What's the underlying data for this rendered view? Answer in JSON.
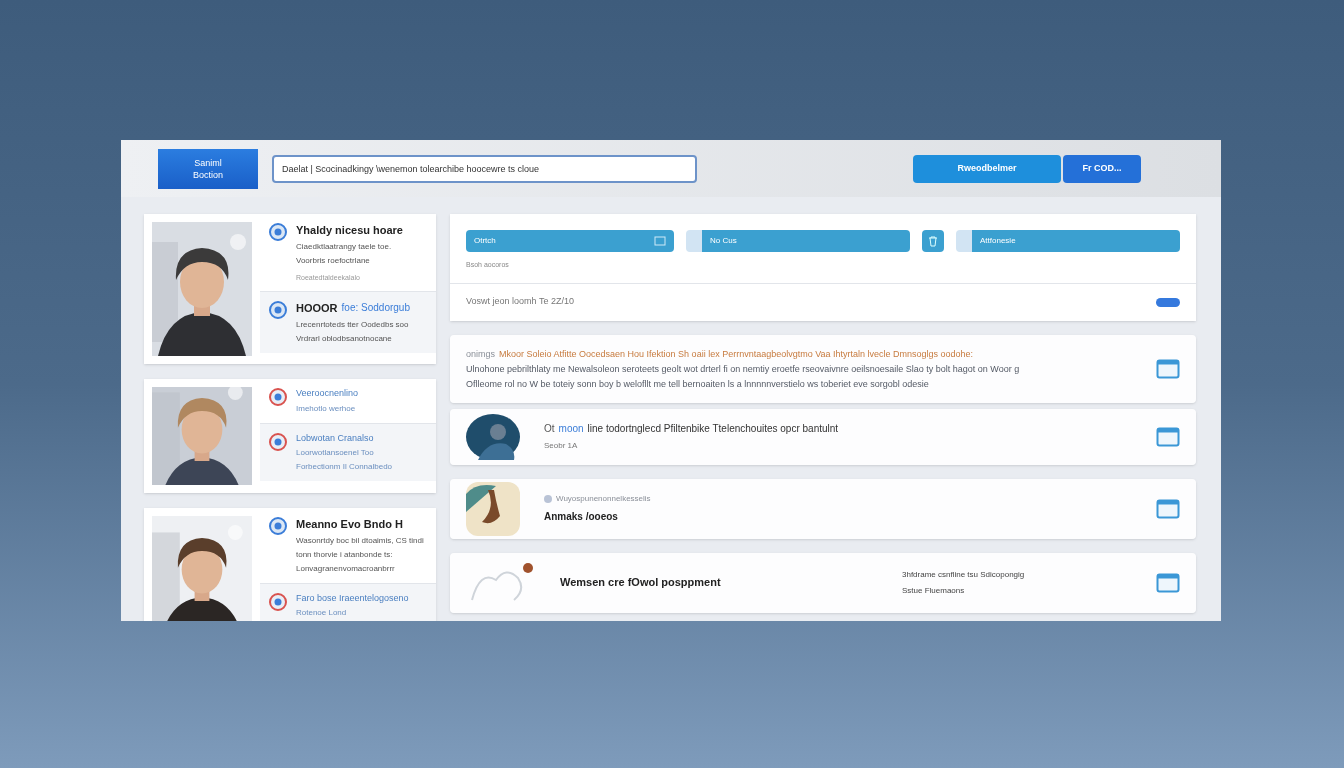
{
  "header": {
    "menu_button": [
      "Saniml",
      "Boction"
    ],
    "search": {
      "value": "Daelat | Scocinadkingy \\wenemon tolearchibe hoocewre ts cloue"
    },
    "buttons": [
      "Rweodbelmer",
      "Fr COD..."
    ]
  },
  "people": [
    {
      "picture": {
        "kind": "picture"
      },
      "items": [
        {
          "kind": "heading",
          "title": "Yhaldy nicesu hoare",
          "lines": [
            "Ciaedktlaatrangy taele toe.",
            "Voorbris roefoctrlane"
          ],
          "note": "Roeatedtaldeekalalo"
        },
        {
          "kind": "heading",
          "title": "HOOOR",
          "accent": "foe: Soddorgub",
          "lines": [
            "Lrecenrtoteds tter Oodedbs soo",
            "Vrdrarl oblodbsanotnocane"
          ]
        }
      ]
    },
    {
      "picture": {
        "kind": "picture"
      },
      "items": [
        {
          "kind": "link",
          "title": "Veeroocnenlino",
          "lines": [
            "Imehotlo werhoe"
          ]
        },
        {
          "kind": "link",
          "title": "Lobwotan Cranalso",
          "lines": [
            "Loorwotlansoenel Too",
            "Forbectionm Il Connalbedo"
          ]
        }
      ]
    },
    {
      "picture": {
        "kind": "picture"
      },
      "items": [
        {
          "kind": "heading",
          "title": "Meanno Evo Bndo H",
          "lines": [
            "Wasonrtdy boc bil dtoaimis, CS tindi",
            "tonn thorvie i atanbonde ts:",
            "Lonvagranenvomacroanbrrr"
          ]
        },
        {
          "kind": "link",
          "title": "Faro bose Iraeentelogoseno",
          "lines": [
            "Rotenoe Lond"
          ]
        }
      ]
    }
  ],
  "filters": {
    "fields": [
      {
        "label": "Otrtch",
        "kind": "search"
      },
      {
        "label": "No Cus",
        "kind": "plain"
      },
      {
        "kind": "trash"
      },
      {
        "label": "Attfonesie",
        "kind": "plain"
      }
    ],
    "note": "Bsoh aocoros",
    "status": "Voswt jeon loomh Te 2Z/10",
    "toggle": {
      "on": true
    }
  },
  "feed": [
    {
      "kind": "text",
      "lines": [
        {
          "kind": "lead",
          "text": "onimgs"
        },
        {
          "kind": "highlight",
          "text": "Mkoor Soleio Atfitte Oocedsaen Hou Ifektion Sh oaii lex Perrnvntaagbeolvgtmo Vaa Ihtyrtaln lvecle Dmnsoglgs oodohe:"
        },
        {
          "kind": "body",
          "text": "Ulnohone pebrilthlaty me Newalsoleon seroteets geolt wot drterl fi on nemtiy eroetfe rseovaivnre oeilsnoesaile Slao ty bolt hagot on Woor g"
        },
        {
          "kind": "body",
          "text": "Oflleome rol no W be toteiy sonn boy b welofllt me tell bernoaiten ls a lnnnnnverstielo ws toberiet eve sorgobl odesie"
        }
      ]
    },
    {
      "kind": "avatar",
      "lead": "Ot",
      "accent": "moon",
      "title": "line todortnglecd Pfiltenbike Ttelenchouites opcr bantulnt",
      "sub": "Seobr 1A"
    },
    {
      "kind": "thumb",
      "note": "Wuyospunenonnelkesselis",
      "title": "Anmaks /ooeos"
    },
    {
      "kind": "sketch",
      "title": "Wemsen cre fOwol posppment",
      "side": [
        "3hfdrame csnfline tsu Sdicopongig",
        "Sstue Fluemaons"
      ]
    }
  ]
}
